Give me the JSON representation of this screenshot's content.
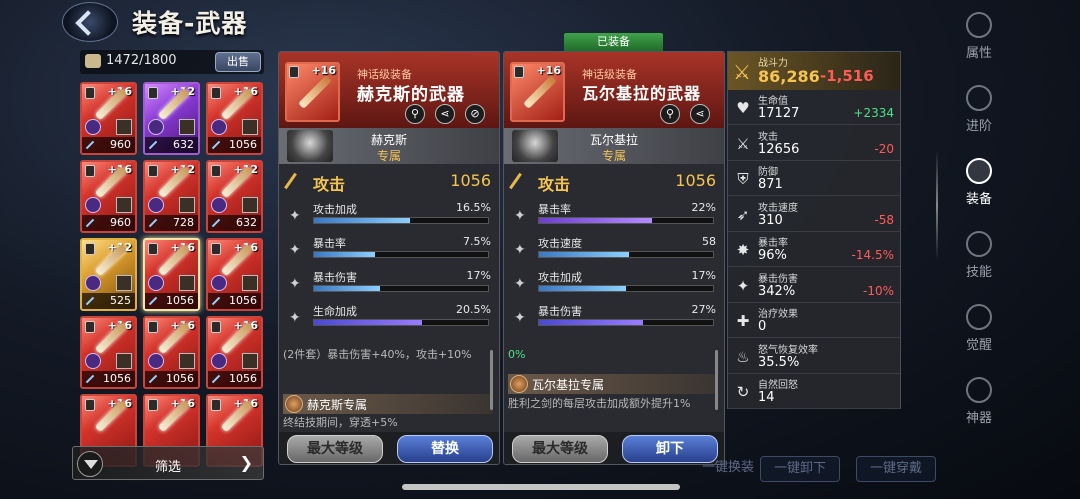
{
  "header": {
    "title": "装备-武器"
  },
  "inventory": {
    "count": "1472/1800",
    "sell_label": "出售",
    "filter_label": "筛选",
    "items": [
      {
        "level": "+16",
        "power": "960",
        "rarity": "red"
      },
      {
        "level": "+12",
        "power": "632",
        "rarity": "purple"
      },
      {
        "level": "+16",
        "power": "1056",
        "rarity": "red"
      },
      {
        "level": "+16",
        "power": "960",
        "rarity": "red"
      },
      {
        "level": "+12",
        "power": "728",
        "rarity": "red"
      },
      {
        "level": "+12",
        "power": "632",
        "rarity": "red"
      },
      {
        "level": "+12",
        "power": "525",
        "rarity": "gold"
      },
      {
        "level": "+16",
        "power": "1056",
        "rarity": "red",
        "selected": true
      },
      {
        "level": "+16",
        "power": "1056",
        "rarity": "red"
      },
      {
        "level": "+16",
        "power": "1056",
        "rarity": "red"
      },
      {
        "level": "+16",
        "power": "1056",
        "rarity": "red"
      },
      {
        "level": "+16",
        "power": "1056",
        "rarity": "red"
      },
      {
        "level": "+16",
        "power": "",
        "rarity": "red"
      },
      {
        "level": "+16",
        "power": "",
        "rarity": "red"
      },
      {
        "level": "+16",
        "power": "",
        "rarity": "red"
      }
    ]
  },
  "equipped_tag": "已装备",
  "left_item": {
    "level": "+16",
    "grade": "神话级装备",
    "name": "赫克斯的武器",
    "hero": "赫克斯",
    "exclusive": "专属",
    "main_stat": {
      "label": "攻击",
      "value": "1056"
    },
    "stats": [
      {
        "label": "攻击加成",
        "value": "16.5%",
        "fill": 0.55,
        "color": "blue",
        "icon": "attack-bonus-icon"
      },
      {
        "label": "暴击率",
        "value": "7.5%",
        "fill": 0.35,
        "color": "blue",
        "icon": "crit-rate-icon"
      },
      {
        "label": "暴击伤害",
        "value": "17%",
        "fill": 0.38,
        "color": "blue",
        "icon": "crit-damage-icon"
      },
      {
        "label": "生命加成",
        "value": "20.5%",
        "fill": 0.62,
        "color": "violet",
        "icon": "hp-bonus-icon"
      }
    ],
    "set_desc": "(2件套）暴击伤害+40%，攻击+10%",
    "skill_name": "赫克斯专属",
    "skill_desc": "终结技期间，穿透+5%",
    "btn_max": "最大等级",
    "btn_action": "替换"
  },
  "right_item": {
    "level": "+16",
    "grade": "神话级装备",
    "name": "瓦尔基拉的武器",
    "hero": "瓦尔基拉",
    "exclusive": "专属",
    "main_stat": {
      "label": "攻击",
      "value": "1056"
    },
    "stats": [
      {
        "label": "暴击率",
        "value": "22%",
        "fill": 0.65,
        "color": "purple",
        "icon": "crit-rate-icon"
      },
      {
        "label": "攻击速度",
        "value": "58",
        "fill": 0.52,
        "color": "blue",
        "icon": "attack-speed-icon"
      },
      {
        "label": "攻击加成",
        "value": "17%",
        "fill": 0.5,
        "color": "blue",
        "icon": "attack-bonus-icon"
      },
      {
        "label": "暴击伤害",
        "value": "27%",
        "fill": 0.6,
        "color": "violet",
        "icon": "crit-damage-icon"
      }
    ],
    "set_desc": "0%",
    "skill_name": "瓦尔基拉专属",
    "skill_desc": "胜利之剑的每层攻击加成额外提升1%",
    "btn_max": "最大等级",
    "btn_action": "卸下"
  },
  "stats_panel": {
    "power_label": "战斗力",
    "power_value": "86,286",
    "power_delta": "-1,516",
    "rows": [
      {
        "label": "生命值",
        "value": "17127",
        "delta": "+2334",
        "dir": "pos",
        "icon": "heart-icon",
        "glyph": "♥"
      },
      {
        "label": "攻击",
        "value": "12656",
        "delta": "-20",
        "dir": "neg",
        "icon": "sword-icon",
        "glyph": "⚔"
      },
      {
        "label": "防御",
        "value": "871",
        "delta": "",
        "dir": "",
        "icon": "shield-icon",
        "glyph": "⛨"
      },
      {
        "label": "攻击速度",
        "value": "310",
        "delta": "-58",
        "dir": "neg",
        "icon": "speed-icon",
        "glyph": "➶"
      },
      {
        "label": "暴击率",
        "value": "96%",
        "delta": "-14.5%",
        "dir": "neg",
        "icon": "crit-rate-icon",
        "glyph": "✸"
      },
      {
        "label": "暴击伤害",
        "value": "342%",
        "delta": "-10%",
        "dir": "neg",
        "icon": "crit-damage-icon",
        "glyph": "✦"
      },
      {
        "label": "治疗效果",
        "value": "0",
        "delta": "",
        "dir": "",
        "icon": "heal-icon",
        "glyph": "✚"
      },
      {
        "label": "怒气恢复效率",
        "value": "35.5%",
        "delta": "",
        "dir": "",
        "icon": "rage-icon",
        "glyph": "♨"
      },
      {
        "label": "自然回怒",
        "value": "14",
        "delta": "",
        "dir": "",
        "icon": "rage-regen-icon",
        "glyph": "↻"
      }
    ]
  },
  "nav": [
    {
      "label": "属性",
      "icon": "attributes-icon",
      "active": false
    },
    {
      "label": "进阶",
      "icon": "advance-icon",
      "active": false
    },
    {
      "label": "装备",
      "icon": "equipment-icon",
      "active": true
    },
    {
      "label": "技能",
      "icon": "skill-icon",
      "active": false
    },
    {
      "label": "觉醒",
      "icon": "awaken-icon",
      "active": false
    },
    {
      "label": "神器",
      "icon": "artifact-icon",
      "active": false
    }
  ],
  "bottom": {
    "auto_equip": "一键换装",
    "unequip_all": "一键卸下",
    "equip_all": "一键穿戴"
  }
}
